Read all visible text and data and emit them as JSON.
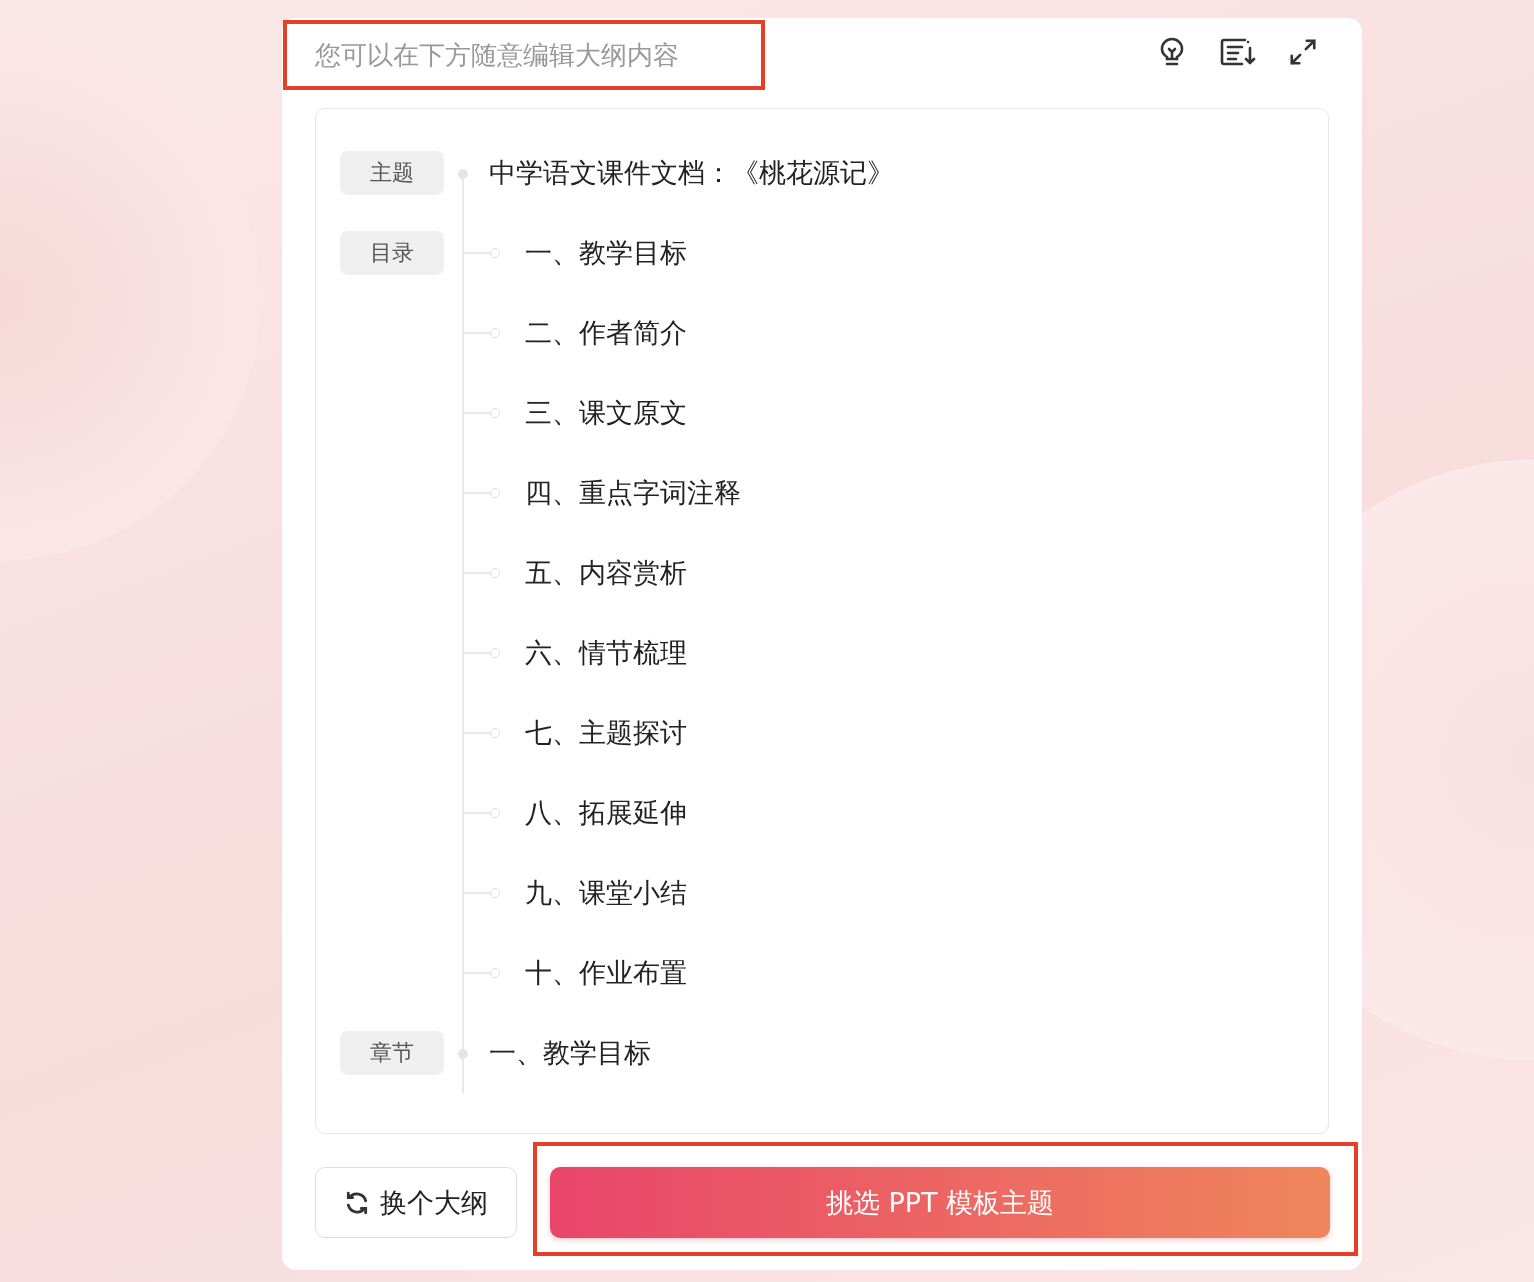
{
  "header": {
    "hint": "您可以在下方随意编辑大纲内容",
    "highlighted": true
  },
  "outline": [
    {
      "tag": "主题",
      "kind": "main",
      "text": "中学语文课件文档：《桃花源记》"
    },
    {
      "tag": "目录",
      "kind": "sub",
      "text": "一、教学目标"
    },
    {
      "kind": "sub",
      "text": "二、作者简介"
    },
    {
      "kind": "sub",
      "text": "三、课文原文"
    },
    {
      "kind": "sub",
      "text": "四、重点字词注释"
    },
    {
      "kind": "sub",
      "text": "五、内容赏析"
    },
    {
      "kind": "sub",
      "text": "六、情节梳理"
    },
    {
      "kind": "sub",
      "text": "七、主题探讨"
    },
    {
      "kind": "sub",
      "text": "八、拓展延伸"
    },
    {
      "kind": "sub",
      "text": "九、课堂小结"
    },
    {
      "kind": "sub",
      "text": "十、作业布置"
    },
    {
      "tag": "章节",
      "kind": "main",
      "text": "一、教学目标"
    }
  ],
  "footer": {
    "secondary": "换个大纲",
    "primary": "挑选 PPT 模板主题",
    "highlighted": true
  }
}
